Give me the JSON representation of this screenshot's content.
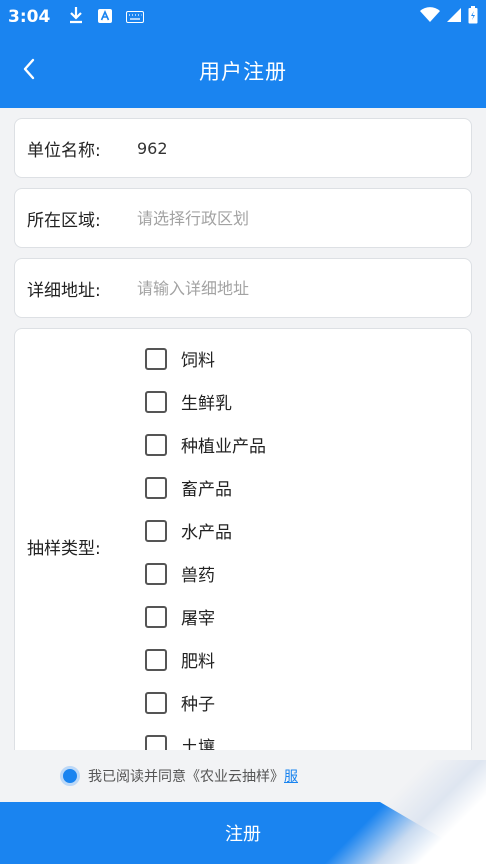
{
  "status_bar": {
    "time": "3:04",
    "icons_left": [
      "download-icon",
      "a-badge-icon",
      "keyboard-icon"
    ],
    "icons_right": [
      "wifi-icon",
      "signal-icon",
      "battery-icon"
    ]
  },
  "app_bar": {
    "title": "用户注册",
    "back_icon": "chevron-left-icon"
  },
  "form": {
    "unit_name": {
      "label": "单位名称:",
      "value": "962"
    },
    "region": {
      "label": "所在区域:",
      "placeholder": "请选择行政区划"
    },
    "address": {
      "label": "详细地址:",
      "placeholder": "请输入详细地址"
    },
    "sample_type": {
      "label": "抽样类型:",
      "options": [
        "饲料",
        "生鲜乳",
        "种植业产品",
        "畜产品",
        "水产品",
        "兽药",
        "屠宰",
        "肥料",
        "种子",
        "土壤"
      ]
    }
  },
  "agreement": {
    "text": "我已阅读并同意《农业云抽样》",
    "link": "服"
  },
  "register_button": {
    "label": "注册"
  },
  "colors": {
    "primary": "#1a84f0",
    "background": "#f2f3f5"
  }
}
